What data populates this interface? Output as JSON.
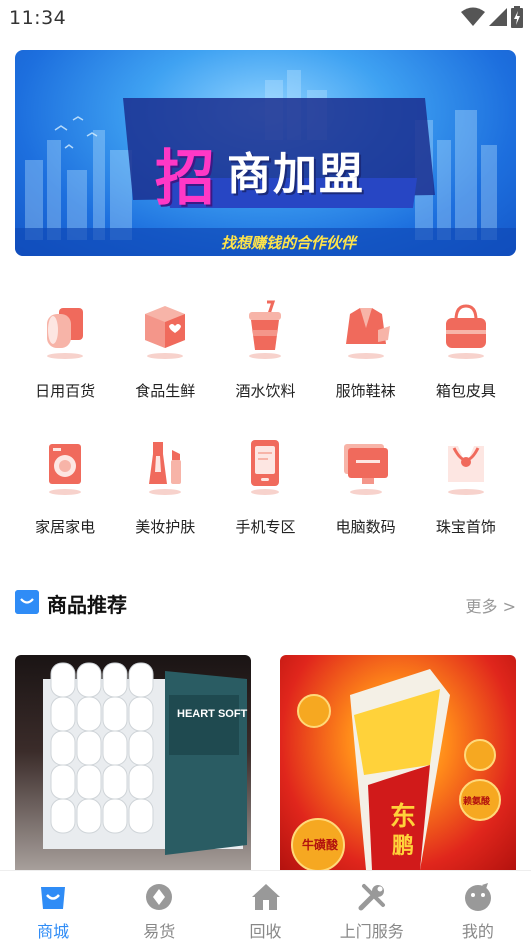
{
  "status_bar": {
    "time": "11:34",
    "icons": [
      "wifi-icon",
      "cell-signal-icon",
      "battery-icon"
    ]
  },
  "banner": {
    "title_char": "招",
    "title_rest": "商加盟",
    "subtitle": "找想赚钱的合作伙伴"
  },
  "categories": [
    {
      "label": "日用百货",
      "icon": "toilet-paper-icon"
    },
    {
      "label": "食品生鲜",
      "icon": "food-box-icon"
    },
    {
      "label": "酒水饮料",
      "icon": "drink-cup-icon"
    },
    {
      "label": "服饰鞋袜",
      "icon": "suit-icon"
    },
    {
      "label": "箱包皮具",
      "icon": "handbag-icon"
    },
    {
      "label": "家居家电",
      "icon": "washing-machine-icon"
    },
    {
      "label": "美妆护肤",
      "icon": "cosmetics-icon"
    },
    {
      "label": "手机专区",
      "icon": "mobile-phone-icon"
    },
    {
      "label": "电脑数码",
      "icon": "computer-monitor-icon"
    },
    {
      "label": "珠宝首饰",
      "icon": "necklace-icon"
    }
  ],
  "section": {
    "title": "商品推荐",
    "more": "更多 >"
  },
  "products": [
    {
      "name": "toilet-paper-product",
      "brand_text": "HEART SOFT"
    },
    {
      "name": "energy-drink-product",
      "bottle_text_1": "东",
      "bottle_text_2": "鹏",
      "tag": "牛磺酸",
      "tag2": "赖氨酸"
    }
  ],
  "tabbar": [
    {
      "label": "商城",
      "icon": "shopping-bag-icon",
      "active": true
    },
    {
      "label": "易货",
      "icon": "barter-icon",
      "active": false
    },
    {
      "label": "回收",
      "icon": "home-icon",
      "active": false
    },
    {
      "label": "上门服务",
      "icon": "tools-icon",
      "active": false
    },
    {
      "label": "我的",
      "icon": "profile-icon",
      "active": false
    }
  ],
  "colors": {
    "accent": "#2f8cf6",
    "icon_coral": "#f06a5c",
    "tab_inactive": "#888888"
  }
}
